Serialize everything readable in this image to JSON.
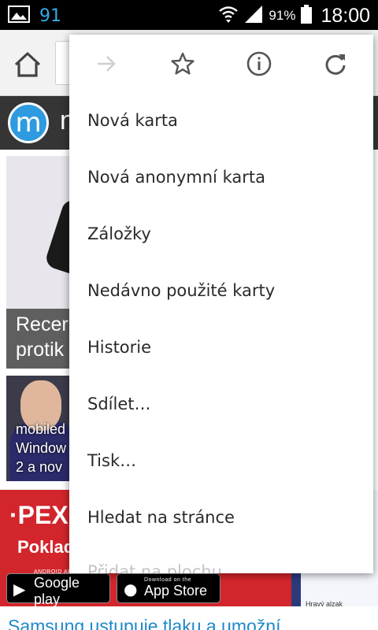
{
  "status_bar": {
    "notification_count": "91",
    "battery_percent": "91%",
    "time": "18:00",
    "icons": [
      "image-icon",
      "wifi-icon",
      "signal-icon",
      "battery-icon"
    ]
  },
  "background_page": {
    "site_title_fragment": "n",
    "logo_letter": "m",
    "card1_lines": [
      "Recer",
      "protik"
    ],
    "card2_lines": [
      "mobiled",
      "Window",
      "2 a nov"
    ],
    "banner_brand": "·PEX",
    "banner_sub": "Poklad",
    "store_buttons": [
      {
        "top": "ANDROID APP ON",
        "main": "Google play"
      },
      {
        "top": "Download on the",
        "main": "App Store"
      }
    ],
    "banner_side_text": "Hravý alzak",
    "bottom_link": "Samsung ustupuje tlaku a umožní"
  },
  "menu": {
    "icon_row": [
      "forward-icon",
      "bookmark-star-icon",
      "info-icon",
      "reload-icon"
    ],
    "items": [
      {
        "label": "Nová karta"
      },
      {
        "label": "Nová anonymní karta"
      },
      {
        "label": "Záložky"
      },
      {
        "label": "Nedávno použité karty"
      },
      {
        "label": "Historie"
      },
      {
        "label": "Sdílet…"
      },
      {
        "label": "Tisk…"
      },
      {
        "label": "Hledat na stránce"
      },
      {
        "label": "Přidat na plochu"
      }
    ]
  },
  "colors": {
    "status_accent": "#37a9e6",
    "site_header": "#353535",
    "banner_red": "#d3252c",
    "link_blue": "#1e88c8"
  }
}
